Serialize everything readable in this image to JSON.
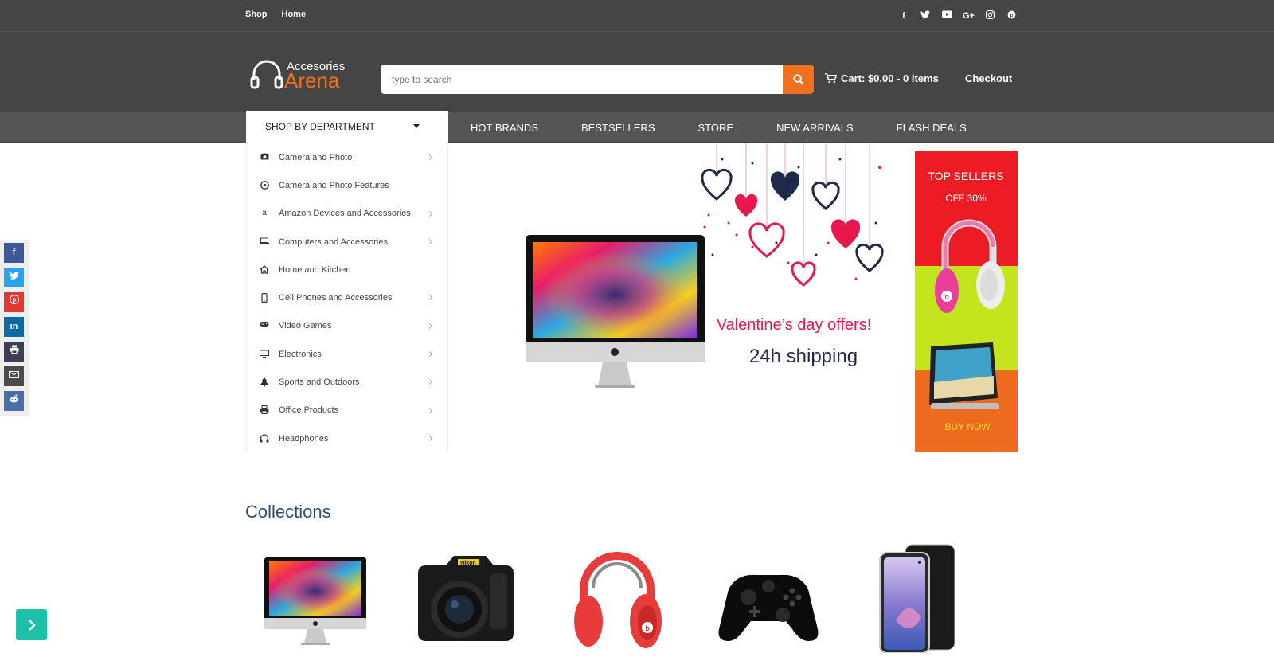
{
  "topbar": {
    "links": [
      "Shop",
      "Home"
    ],
    "social_icons": [
      "facebook-icon",
      "twitter-icon",
      "youtube-icon",
      "google-plus-icon",
      "instagram-icon",
      "pinterest-icon"
    ]
  },
  "header": {
    "logo_line1": "Accesories",
    "logo_line2": "Arena",
    "search_placeholder": "type to search",
    "cart_label": "Cart: $0.00 - 0 items",
    "checkout_label": "Checkout"
  },
  "nav": {
    "dept_label": "SHOP BY DEPARTMENT",
    "menu": [
      "HOT BRANDS",
      "BESTSELLERS",
      "STORE",
      "NEW ARRIVALS",
      "FLASH DEALS"
    ]
  },
  "departments": [
    {
      "label": "Camera and Photo",
      "icon": "camera-icon",
      "has_sub": true
    },
    {
      "label": "Camera and Photo Features",
      "icon": "aperture-icon",
      "has_sub": false
    },
    {
      "label": "Amazon Devices and Accessories",
      "icon": "amazon-icon",
      "has_sub": true
    },
    {
      "label": "Computers and Accessories",
      "icon": "laptop-icon",
      "has_sub": true
    },
    {
      "label": "Home and Kitchen",
      "icon": "home-icon",
      "has_sub": false
    },
    {
      "label": "Cell Phones and Accessories",
      "icon": "mobile-icon",
      "has_sub": true
    },
    {
      "label": "Video Games",
      "icon": "gamepad-icon",
      "has_sub": true
    },
    {
      "label": "Electronics",
      "icon": "monitor-icon",
      "has_sub": true
    },
    {
      "label": "Sports and Outdoors",
      "icon": "tree-icon",
      "has_sub": true
    },
    {
      "label": "Office Products",
      "icon": "printer-icon",
      "has_sub": true
    },
    {
      "label": "Headphones",
      "icon": "headphones-icon",
      "has_sub": true
    }
  ],
  "banner": {
    "headline": "Valentine’s day offers!",
    "subline": "24h shipping"
  },
  "side_ad": {
    "title": "TOP SELLERS",
    "subtitle": "OFF 30%",
    "cta": "BUY NOW"
  },
  "share_bar": [
    "facebook",
    "twitter",
    "pinterest",
    "linkedin",
    "print",
    "email",
    "reddit"
  ],
  "collections": {
    "title": "Collections",
    "items": [
      "imac",
      "camera",
      "headphones",
      "controller",
      "phone"
    ]
  },
  "colors": {
    "accent": "#f0701e",
    "header_bg": "#454545",
    "nav_bg": "#555555",
    "collections_title": "#2a4f6e",
    "fab": "#1dbfa8"
  }
}
